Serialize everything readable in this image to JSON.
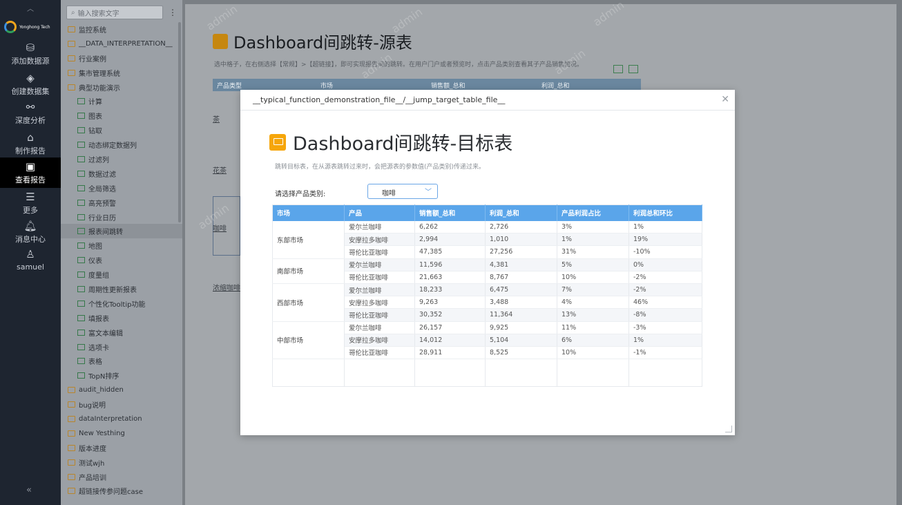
{
  "rail": {
    "logo_text": "Yonghong Tech",
    "items": [
      {
        "label": "添加数据源",
        "icon": "database-icon"
      },
      {
        "label": "创建数据集",
        "icon": "layers-icon"
      },
      {
        "label": "深度分析",
        "icon": "analysis-icon"
      },
      {
        "label": "制作报告",
        "icon": "report-build-icon"
      },
      {
        "label": "查看报告",
        "icon": "report-view-icon"
      },
      {
        "label": "更多",
        "icon": "menu-icon"
      },
      {
        "label": "消息中心",
        "icon": "bell-icon"
      },
      {
        "label": "samuel",
        "icon": "user-icon"
      }
    ],
    "collapse": "«"
  },
  "tree": {
    "search_placeholder": "输入搜索文字",
    "items": [
      {
        "label": "监控系统",
        "type": "folder"
      },
      {
        "label": "__DATA_INTERPRETATION__",
        "type": "folder"
      },
      {
        "label": "行业案例",
        "type": "folder"
      },
      {
        "label": "集市管理系统",
        "type": "folder"
      },
      {
        "label": "典型功能演示",
        "type": "folder"
      },
      {
        "label": "计算",
        "type": "file"
      },
      {
        "label": "图表",
        "type": "file"
      },
      {
        "label": "钻取",
        "type": "file"
      },
      {
        "label": "动态绑定数据列",
        "type": "file"
      },
      {
        "label": "过滤列",
        "type": "file"
      },
      {
        "label": "数据过滤",
        "type": "file"
      },
      {
        "label": "全局筛选",
        "type": "file"
      },
      {
        "label": "高亮预警",
        "type": "file"
      },
      {
        "label": "行业日历",
        "type": "file"
      },
      {
        "label": "报表间跳转",
        "type": "file",
        "selected": true
      },
      {
        "label": "地图",
        "type": "file"
      },
      {
        "label": "仪表",
        "type": "file"
      },
      {
        "label": "度量组",
        "type": "file"
      },
      {
        "label": "周期性更新报表",
        "type": "file"
      },
      {
        "label": "个性化Tooltip功能",
        "type": "file"
      },
      {
        "label": "填报表",
        "type": "file"
      },
      {
        "label": "富文本编辑",
        "type": "file"
      },
      {
        "label": "选项卡",
        "type": "file"
      },
      {
        "label": "表格",
        "type": "file"
      },
      {
        "label": "TopN排序",
        "type": "file"
      },
      {
        "label": "audit_hidden",
        "type": "folder"
      },
      {
        "label": "bug说明",
        "type": "folder"
      },
      {
        "label": "dataInterpretation",
        "type": "folder"
      },
      {
        "label": "New Yesthing",
        "type": "folder"
      },
      {
        "label": "版本进度",
        "type": "folder"
      },
      {
        "label": "测试wjh",
        "type": "folder"
      },
      {
        "label": "产品培训",
        "type": "folder"
      },
      {
        "label": "超链接传参问题case",
        "type": "folder"
      }
    ]
  },
  "dash": {
    "title": "Dashboard间跳转-源表",
    "desc": "选中格子，在右侧选择【常规】>【超链接】，即可实现报告间的跳转。在用户门户或者预览时，点击产品类别查看其子产品销售情况。",
    "headers": [
      "产品类型",
      "市场",
      "销售额_总和",
      "利润_总和"
    ],
    "cells": [
      "茶",
      "花茶",
      "咖啡",
      "浓缩咖啡"
    ]
  },
  "modal": {
    "path": "__typical_function_demonstration_file__/__jump_target_table_file__",
    "title": "Dashboard间跳转-目标表",
    "desc": "跳转目标表，在从源表跳转过来时，会把源表的参数值(产品类别)传递过来。",
    "filter_label": "请选择产品类别:",
    "filter_value": "咖啡",
    "columns": [
      "市场",
      "产品",
      "销售额_总和",
      "利润_总和",
      "产品利润占比",
      "利润总和环比"
    ],
    "groups": [
      {
        "market": "东部市场",
        "rows": [
          [
            "爱尔兰咖啡",
            "6,262",
            "2,726",
            "3%",
            "1%"
          ],
          [
            "安摩拉多咖啡",
            "2,994",
            "1,010",
            "1%",
            "19%"
          ],
          [
            "哥伦比亚咖啡",
            "47,385",
            "27,256",
            "31%",
            "-10%"
          ]
        ]
      },
      {
        "market": "南部市场",
        "rows": [
          [
            "爱尔兰咖啡",
            "11,596",
            "4,381",
            "5%",
            "0%"
          ],
          [
            "哥伦比亚咖啡",
            "21,663",
            "8,767",
            "10%",
            "-2%"
          ]
        ]
      },
      {
        "market": "西部市场",
        "rows": [
          [
            "爱尔兰咖啡",
            "18,233",
            "6,475",
            "7%",
            "-2%"
          ],
          [
            "安摩拉多咖啡",
            "9,263",
            "3,488",
            "4%",
            "46%"
          ],
          [
            "哥伦比亚咖啡",
            "30,352",
            "11,364",
            "13%",
            "-8%"
          ]
        ]
      },
      {
        "market": "中部市场",
        "rows": [
          [
            "爱尔兰咖啡",
            "26,157",
            "9,925",
            "11%",
            "-3%"
          ],
          [
            "安摩拉多咖啡",
            "14,012",
            "5,104",
            "6%",
            "1%"
          ],
          [
            "哥伦比亚咖啡",
            "28,911",
            "8,525",
            "10%",
            "-1%"
          ]
        ]
      }
    ]
  },
  "watermark": "admin"
}
